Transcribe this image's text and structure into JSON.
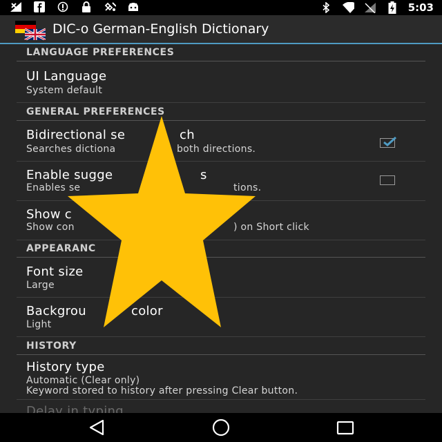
{
  "status": {
    "time": "5:03"
  },
  "icons": {
    "status_left": [
      "signal-cross-icon",
      "facebook-icon",
      "sync-icon",
      "lock-icon",
      "satellite-icon",
      "android-icon"
    ],
    "status_right": [
      "bluetooth-icon",
      "wifi-icon",
      "cell-signal-icon",
      "battery-icon"
    ],
    "nav": [
      "back-icon",
      "home-icon",
      "recents-icon"
    ]
  },
  "app": {
    "title": "DIC-o German-English Dictionary"
  },
  "sections": {
    "language": "LANGUAGE PREFERENCES",
    "general": "GENERAL PREFERENCES",
    "appearance": "APPEARANC",
    "history": "HISTORY"
  },
  "prefs": {
    "ui_language": {
      "title": "UI Language",
      "summary": "System default"
    },
    "bidirectional": {
      "title": "Bidirectional se",
      "title_tail": "ch",
      "summary": "Searches dictiona",
      "summary_tail": "both directions.",
      "checked": true
    },
    "suggestions": {
      "title": "Enable sugge",
      "title_tail": "s",
      "summary": "Enables se",
      "summary_tail": "tions.",
      "checked": false
    },
    "show": {
      "title": "Show c",
      "summary": "Show con",
      "summary_tail": ") on Short click"
    },
    "font_size": {
      "title": "Font size",
      "summary": "Large"
    },
    "background": {
      "title": "Backgrou",
      "title_tail": "color",
      "summary": "Light"
    },
    "history_type": {
      "title": "History type",
      "summary": "Automatic (Clear only)",
      "summary2": "Keyword stored to history after pressing Clear button."
    },
    "delay": {
      "title": "Delay in typing"
    }
  },
  "colors": {
    "accent": "#4f9bc3",
    "star": "#FFC107",
    "background": "#262626"
  }
}
